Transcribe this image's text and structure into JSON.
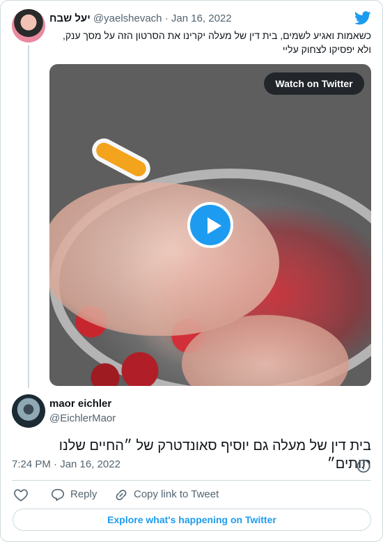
{
  "parent_tweet": {
    "display_name": "יעל שבח",
    "handle": "@yaelshevach",
    "separator": "·",
    "date": "Jan 16, 2022",
    "text_line1": "כשאמות ואגיע לשמים, בית דין של מעלה יקרינו את הסרטון הזה על מסך ענק,",
    "text_line2": "ולא יפסיקו לצחוק עליי",
    "watch_label": "Watch on Twitter"
  },
  "tweet": {
    "display_name": "maor eichler",
    "handle": "@EichlerMaor",
    "text": "בית דין של מעלה גם יוסיף סאונדטרק של ״החיים שלנו תותים״",
    "timestamp": "7:24 PM · Jan 16, 2022"
  },
  "actions": {
    "reply_label": "Reply",
    "copy_label": "Copy link to Tweet"
  },
  "explore_label": "Explore what's happening on Twitter",
  "colors": {
    "twitter_blue": "#1d9bf0",
    "secondary_text": "#536471",
    "border": "#cfd9de"
  },
  "icons": {
    "brand": "twitter-bird-icon",
    "play": "play-icon",
    "info": "info-icon",
    "like": "heart-icon",
    "reply": "reply-bubble-icon",
    "copy": "link-icon"
  }
}
